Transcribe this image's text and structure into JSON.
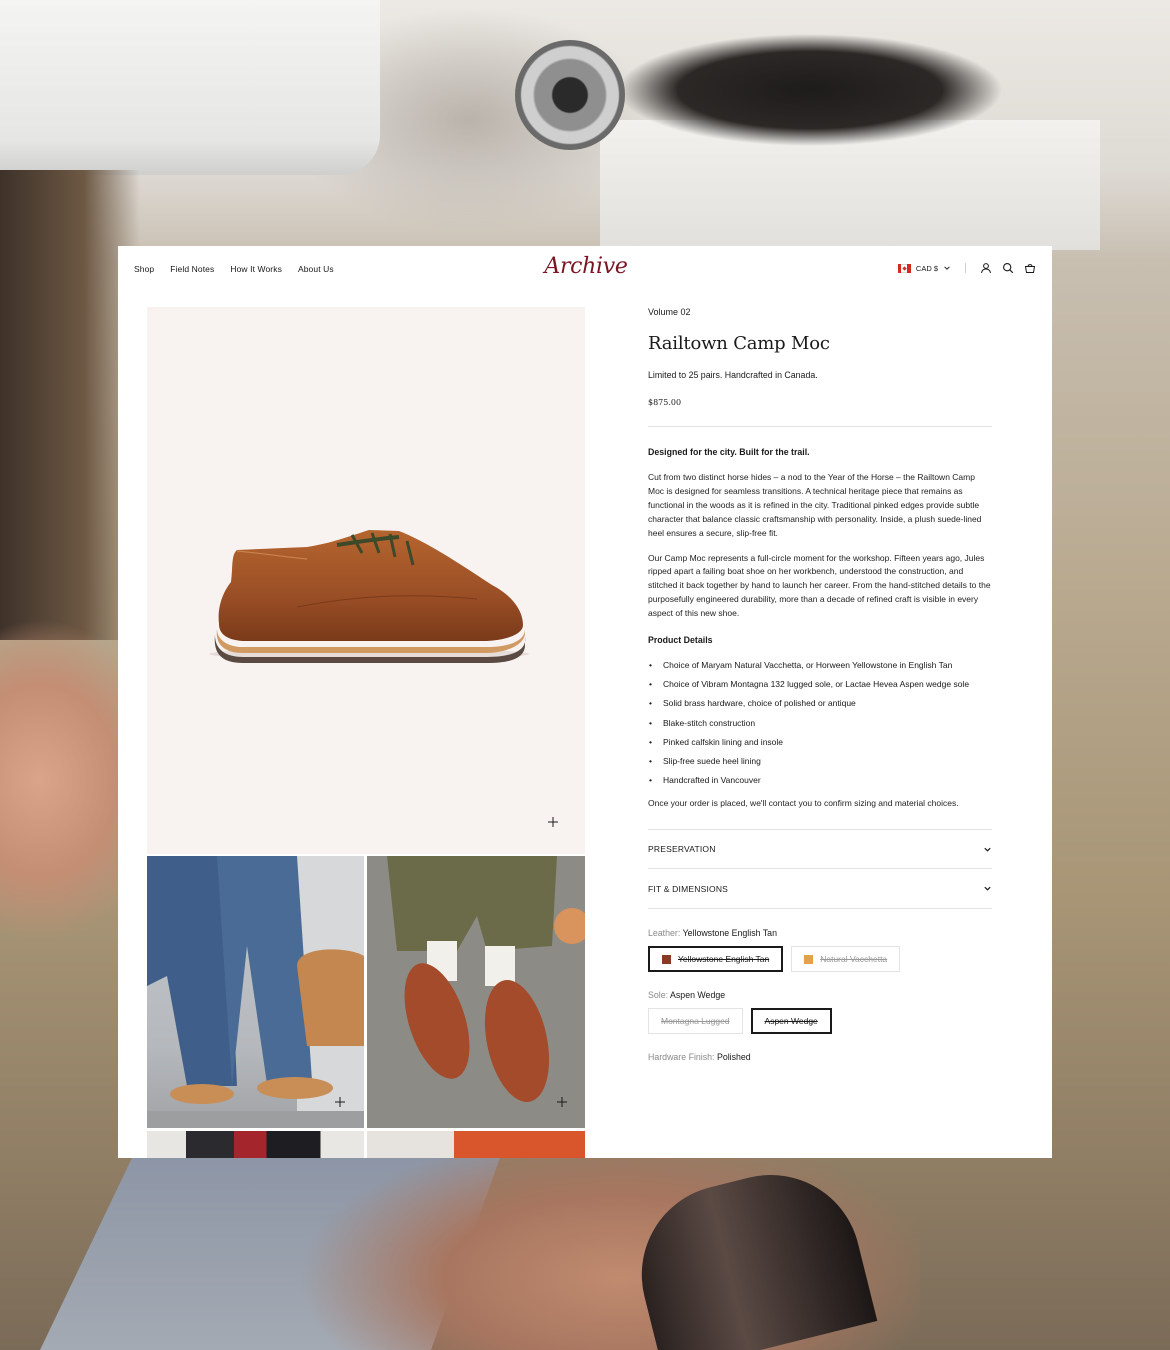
{
  "header": {
    "nav": [
      "Shop",
      "Field Notes",
      "How It Works",
      "About Us"
    ],
    "logo": "Archive",
    "currency": "CAD $",
    "icons": [
      "account-icon",
      "search-icon",
      "cart-icon"
    ]
  },
  "product": {
    "volume": "Volume 02",
    "title": "Railtown Camp Moc",
    "tagline": "Limited to 25 pairs. Handcrafted in Canada.",
    "price": "$875.00",
    "intro_heading": "Designed for the city. Built for the trail.",
    "paragraph_1": "Cut from two distinct horse hides – a nod to the Year of the Horse – the Railtown Camp Moc is designed for seamless transitions. A technical heritage piece that remains as functional in the woods as it is refined in the city. Traditional pinked edges provide subtle character that balance classic craftsmanship with personality. Inside, a plush suede-lined heel ensures a secure, slip-free fit.",
    "paragraph_2": "Our Camp Moc represents a full-circle moment for the workshop. Fifteen years ago, Jules ripped apart a failing boat shoe on her workbench, understood the construction, and stitched it back together by hand to launch her career. From the hand-stitched details to the purposefully engineered durability, more than a decade of refined craft is visible in every aspect of this new shoe.",
    "details_heading": "Product Details",
    "details": [
      "Choice of Maryam Natural Vacchetta, or Horween Yellowstone in English Tan",
      "Choice of Vibram Montagna 132 lugged sole, or Lactae Hevea Aspen wedge sole",
      "Solid brass hardware, choice of polished or antique",
      "Blake-stitch construction",
      "Pinked calfskin lining and insole",
      "Slip-free suede heel lining",
      "Handcrafted in Vancouver"
    ],
    "order_note": "Once your order is placed, we'll contact you to confirm sizing and material choices."
  },
  "accordions": [
    "PRESERVATION",
    "FIT & DIMENSIONS"
  ],
  "options": {
    "leather": {
      "label": "Leather:",
      "selected": "Yellowstone English Tan",
      "choices": [
        {
          "name": "Yellowstone English Tan",
          "color": "#8a3a22",
          "selected": true
        },
        {
          "name": "Natural Vacchetta",
          "color": "#e0a24a",
          "selected": false
        }
      ]
    },
    "sole": {
      "label": "Sole:",
      "selected": "Aspen Wedge",
      "choices": [
        {
          "name": "Montagna Lugged",
          "selected": false
        },
        {
          "name": "Aspen Wedge",
          "selected": true
        }
      ]
    },
    "hardware": {
      "label": "Hardware Finish:",
      "selected": "Polished"
    }
  },
  "colors": {
    "brand": "#7a1524",
    "text": "#1a1a1a",
    "image_bg": "#f8f3f1"
  }
}
